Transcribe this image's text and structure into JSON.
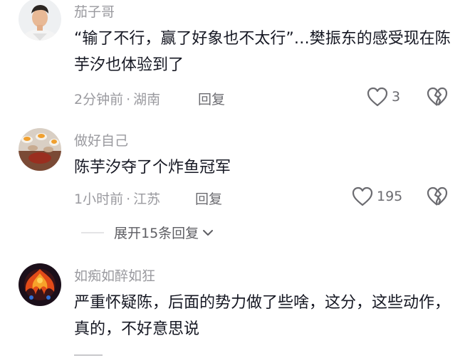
{
  "comments": [
    {
      "username": "茄子哥",
      "text": "“输了不行，赢了好象也不太行”…樊振东的感受现在陈芋汐也体验到了",
      "time": "2分钟前",
      "location": "湖南",
      "reply_label": "回复",
      "likes": "3"
    },
    {
      "username": "做好自己",
      "text": "陈芋汐夺了个炸鱼冠军",
      "time": "1小时前",
      "location": "江苏",
      "reply_label": "回复",
      "likes": "195",
      "expand_replies": "展开15条回复"
    },
    {
      "username": "如痴如醉如狂",
      "text": "严重怀疑陈，后面的势力做了些啥，这分，这些动作，真的，不好意思说"
    }
  ],
  "colors": {
    "secondary_text": "#9a9a9f",
    "primary_text": "#161823",
    "icon": "#6b6b70"
  },
  "icons": {
    "like": "heart-outline-icon",
    "dislike": "broken-heart-icon",
    "expand": "chevron-down-icon"
  }
}
